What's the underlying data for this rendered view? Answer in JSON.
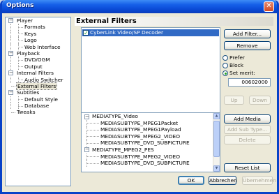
{
  "window": {
    "title": "Options",
    "close_glyph": "✕"
  },
  "tree": [
    {
      "label": "Player",
      "expander": "−",
      "level": 0
    },
    {
      "label": "Formats",
      "level": 1
    },
    {
      "label": "Keys",
      "level": 1
    },
    {
      "label": "Logo",
      "level": 1
    },
    {
      "label": "Web Interface",
      "level": 1
    },
    {
      "label": "Playback",
      "expander": "−",
      "level": 0
    },
    {
      "label": "DVD/OGM",
      "level": 1
    },
    {
      "label": "Output",
      "level": 1
    },
    {
      "label": "Internal Filters",
      "expander": "−",
      "level": 0
    },
    {
      "label": "Audio Switcher",
      "level": 1
    },
    {
      "label": "External Filters",
      "level": 0,
      "selected": true
    },
    {
      "label": "Subtitles",
      "expander": "−",
      "level": 0
    },
    {
      "label": "Default Style",
      "level": 1
    },
    {
      "label": "Database",
      "level": 1
    },
    {
      "label": "Tweaks",
      "level": 0
    }
  ],
  "header": {
    "title": "External Filters"
  },
  "filters": [
    {
      "label": "CyberLink Video/SP Decoder",
      "checked": true,
      "check_glyph": "✓"
    }
  ],
  "buttons": {
    "add_filter": "Add Filter...",
    "remove": "Remove",
    "up": "Up",
    "down": "Down",
    "add_media_type": "Add Media Type...",
    "add_sub_type": "Add Sub Type...",
    "delete": "Delete",
    "reset_list": "Reset List",
    "ok": "OK",
    "cancel": "Abbrechen",
    "apply": "Übernehmen"
  },
  "merit": {
    "options": [
      "Prefer",
      "Block",
      "Set merit:"
    ],
    "selected": "Set merit:",
    "value": "00602000"
  },
  "media_types": [
    {
      "label": "MEDIATYPE_Video",
      "level": 0,
      "expander": "−"
    },
    {
      "label": "MEDIASUBTYPE_MPEG1Packet",
      "level": 1
    },
    {
      "label": "MEDIASUBTYPE_MPEG1Payload",
      "level": 1
    },
    {
      "label": "MEDIASUBTYPE_MPEG2_VIDEO",
      "level": 1
    },
    {
      "label": "MEDIASUBTYPE_DVD_SUBPICTURE",
      "level": 1
    },
    {
      "label": "MEDIATYPE_MPEG2_PES",
      "level": 0,
      "expander": "−"
    },
    {
      "label": "MEDIASUBTYPE_MPEG2_VIDEO",
      "level": 1
    },
    {
      "label": "MEDIASUBTYPE_DVD_SUBPICTURE",
      "level": 1
    }
  ],
  "scroll_arrows": {
    "up": "▲",
    "down": "▼"
  },
  "colors": {
    "titlebar": "#0a4ad6",
    "selection": "#316ac5",
    "dialog_bg": "#ece9d8"
  }
}
